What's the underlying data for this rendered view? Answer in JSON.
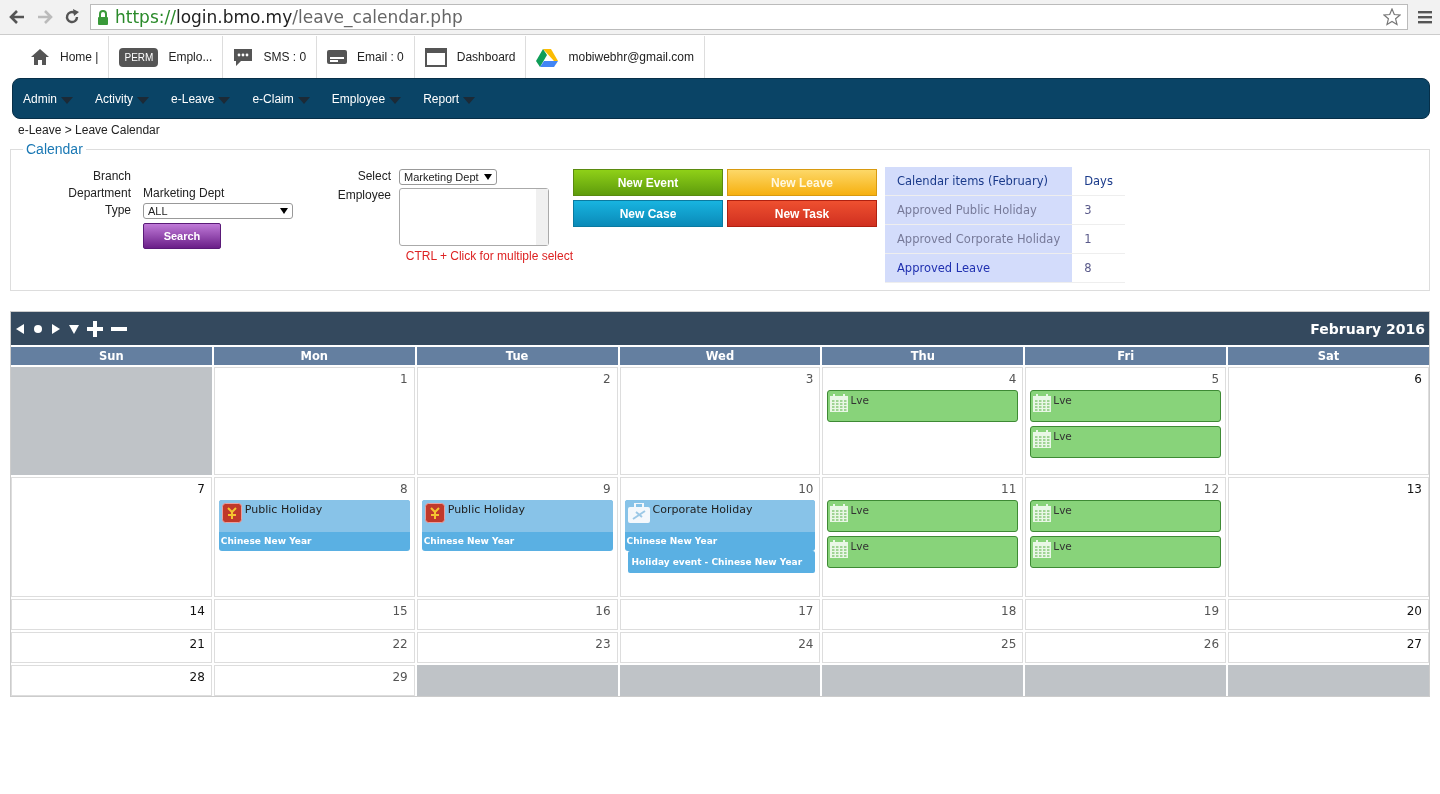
{
  "browser": {
    "url_scheme": "https://",
    "url_host": "login.bmo.my",
    "url_path": "/leave_calendar.php",
    "forward_disabled": true
  },
  "topbar": [
    {
      "label": "Home |"
    },
    {
      "badge": "PERM",
      "label": "Emplo..."
    },
    {
      "label": "SMS : 0"
    },
    {
      "label": "Email : 0"
    },
    {
      "label": "Dashboard"
    },
    {
      "label": "mobiwebhr@gmail.com"
    }
  ],
  "menu": [
    "Admin",
    "Activity",
    "e-Leave",
    "e-Claim",
    "Employee",
    "Report"
  ],
  "breadcrumb": "e-Leave > Leave Calendar",
  "filter": {
    "legend": "Calendar",
    "fields": [
      {
        "kind": "text",
        "label": "Branch"
      },
      {
        "kind": "text",
        "label": "Department",
        "value": "Marketing Dept"
      },
      {
        "kind": "select",
        "label": "Type",
        "value": "ALL"
      }
    ],
    "search_button": "Search",
    "select_label": "Select",
    "select_value": "Marketing Dept",
    "employee_label": "Employee",
    "hint": "CTRL + Click for multiple select",
    "buttons": [
      {
        "label": "New Event",
        "kind": "green"
      },
      {
        "label": "New Leave",
        "kind": "yellow"
      },
      {
        "label": "New Case",
        "kind": "blue"
      },
      {
        "label": "New Task",
        "kind": "red"
      }
    ]
  },
  "summary": {
    "columns": [
      "Calendar items (February)",
      "Days"
    ],
    "rows": [
      {
        "label": "Approved Public Holiday",
        "days": "3",
        "kind": "plain"
      },
      {
        "label": "Approved Corporate Holiday",
        "days": "1",
        "kind": "plain"
      },
      {
        "label": "Approved Leave",
        "days": "8",
        "kind": "link"
      }
    ]
  },
  "calendar": {
    "title": "February 2016",
    "days": [
      "Sun",
      "Mon",
      "Tue",
      "Wed",
      "Thu",
      "Fri",
      "Sat"
    ],
    "weeks": [
      [
        {
          "outside": true
        },
        {
          "outside": false,
          "day": "1"
        },
        {
          "outside": false,
          "day": "2"
        },
        {
          "outside": false,
          "day": "3"
        },
        {
          "outside": false,
          "day": "4",
          "events": [
            {
              "kind": "leave",
              "title": "Lve"
            }
          ]
        },
        {
          "outside": false,
          "day": "5",
          "events": [
            {
              "kind": "leave",
              "title": "Lve"
            },
            {
              "kind": "leave",
              "title": "Lve"
            }
          ]
        },
        {
          "outside": false,
          "day": "6"
        }
      ],
      [
        {
          "outside": false,
          "day": "7"
        },
        {
          "outside": false,
          "day": "8",
          "events": [
            {
              "kind": "public_holiday",
              "title": "Public Holiday",
              "subtitle": "Chinese New Year"
            }
          ]
        },
        {
          "outside": false,
          "day": "9",
          "events": [
            {
              "kind": "public_holiday",
              "title": "Public Holiday",
              "subtitle": "Chinese New Year"
            }
          ]
        },
        {
          "outside": false,
          "day": "10",
          "events": [
            {
              "kind": "corporate_holiday",
              "title": "Corporate Holiday",
              "subtitle": "Chinese New Year"
            },
            {
              "kind": "holiday_event",
              "title": "Holiday event - Chinese New Year"
            }
          ]
        },
        {
          "outside": false,
          "day": "11",
          "events": [
            {
              "kind": "leave",
              "title": "Lve"
            },
            {
              "kind": "leave",
              "title": "Lve"
            }
          ]
        },
        {
          "outside": false,
          "day": "12",
          "events": [
            {
              "kind": "leave",
              "title": "Lve"
            },
            {
              "kind": "leave",
              "title": "Lve"
            }
          ]
        },
        {
          "outside": false,
          "day": "13"
        }
      ],
      [
        {
          "outside": false,
          "day": "14"
        },
        {
          "outside": false,
          "day": "15"
        },
        {
          "outside": false,
          "day": "16"
        },
        {
          "outside": false,
          "day": "17"
        },
        {
          "outside": false,
          "day": "18"
        },
        {
          "outside": false,
          "day": "19"
        },
        {
          "outside": false,
          "day": "20"
        }
      ],
      [
        {
          "outside": false,
          "day": "21"
        },
        {
          "outside": false,
          "day": "22"
        },
        {
          "outside": false,
          "day": "23"
        },
        {
          "outside": false,
          "day": "24"
        },
        {
          "outside": false,
          "day": "25"
        },
        {
          "outside": false,
          "day": "26"
        },
        {
          "outside": false,
          "day": "27"
        }
      ],
      [
        {
          "outside": false,
          "day": "28"
        },
        {
          "outside": false,
          "day": "29"
        },
        {
          "outside": true
        },
        {
          "outside": true
        },
        {
          "outside": true
        },
        {
          "outside": true
        },
        {
          "outside": true
        }
      ]
    ]
  }
}
